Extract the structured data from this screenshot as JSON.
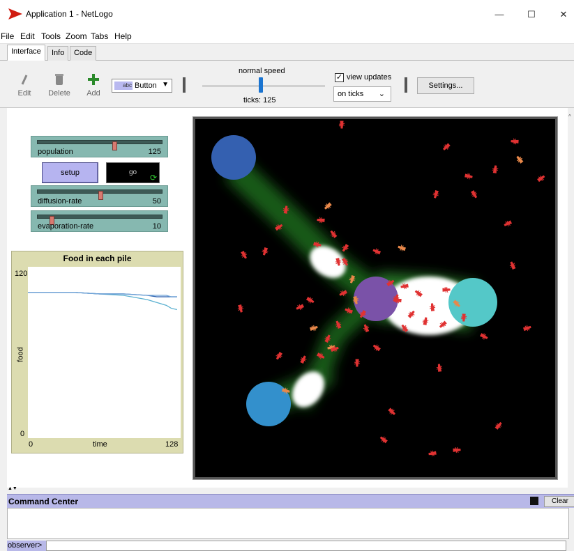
{
  "window": {
    "title": "Application 1 - NetLogo",
    "minimize": "—",
    "maximize": "☐",
    "close": "✕"
  },
  "menu": [
    "File",
    "Edit",
    "Tools",
    "Zoom",
    "Tabs",
    "Help"
  ],
  "tabs": [
    "Interface",
    "Info",
    "Code"
  ],
  "toolbar": {
    "edit_label": "Edit",
    "delete_label": "Delete",
    "add_label": "Add",
    "widget_type_abc": "abc",
    "widget_type": "Button",
    "speed_label": "normal speed",
    "speed_fraction": 0.48,
    "ticks_text": "ticks: 125",
    "view_updates_label": "view updates",
    "view_updates_checked": true,
    "update_mode": "on ticks",
    "settings_label": "Settings..."
  },
  "widgets": {
    "population": {
      "name": "population",
      "value": "125",
      "fraction": 0.62
    },
    "setup": "setup",
    "go": "go",
    "diffusion_rate": {
      "name": "diffusion-rate",
      "value": "50",
      "fraction": 0.5
    },
    "evaporation_rate": {
      "name": "evaporation-rate",
      "value": "10",
      "fraction": 0.1
    }
  },
  "plot": {
    "title": "Food in each pile",
    "ylabel": "food",
    "xlabel": "time",
    "ymax_label": "120",
    "ymin_label": "0",
    "xmin_label": "0",
    "xmax_label": "128"
  },
  "chart_data": {
    "type": "line",
    "title": "Food in each pile",
    "xlabel": "time",
    "ylabel": "food",
    "xlim": [
      0,
      128
    ],
    "ylim": [
      0,
      120
    ],
    "x": [
      0,
      40,
      60,
      80,
      100,
      108,
      116,
      120,
      125
    ],
    "series": [
      {
        "color": "#5ab0d0",
        "values": [
          102,
          102,
          101,
          100,
          97,
          95,
          93,
          91,
          90
        ]
      },
      {
        "color": "#2d62b0",
        "values": [
          102,
          102,
          101,
          101,
          100,
          99,
          99,
          99,
          99
        ]
      },
      {
        "color": "#70a4d8",
        "values": [
          102,
          102,
          101,
          101,
          100,
          100,
          100,
          99,
          99
        ]
      }
    ]
  },
  "command_center": {
    "title": "Command Center",
    "clear_label": "Clear",
    "prompt": "observer>"
  },
  "colors": {
    "slider": "#86b8b0",
    "button": "#b6b4f0",
    "plot_bg": "#dcdcb0",
    "world_bg": "#000000",
    "ant": "#e03232",
    "food_pile_1": "#54c8c8",
    "food_pile_2": "#3390cc",
    "food_pile_3": "#3460b0",
    "nest": "#7a52a8"
  }
}
